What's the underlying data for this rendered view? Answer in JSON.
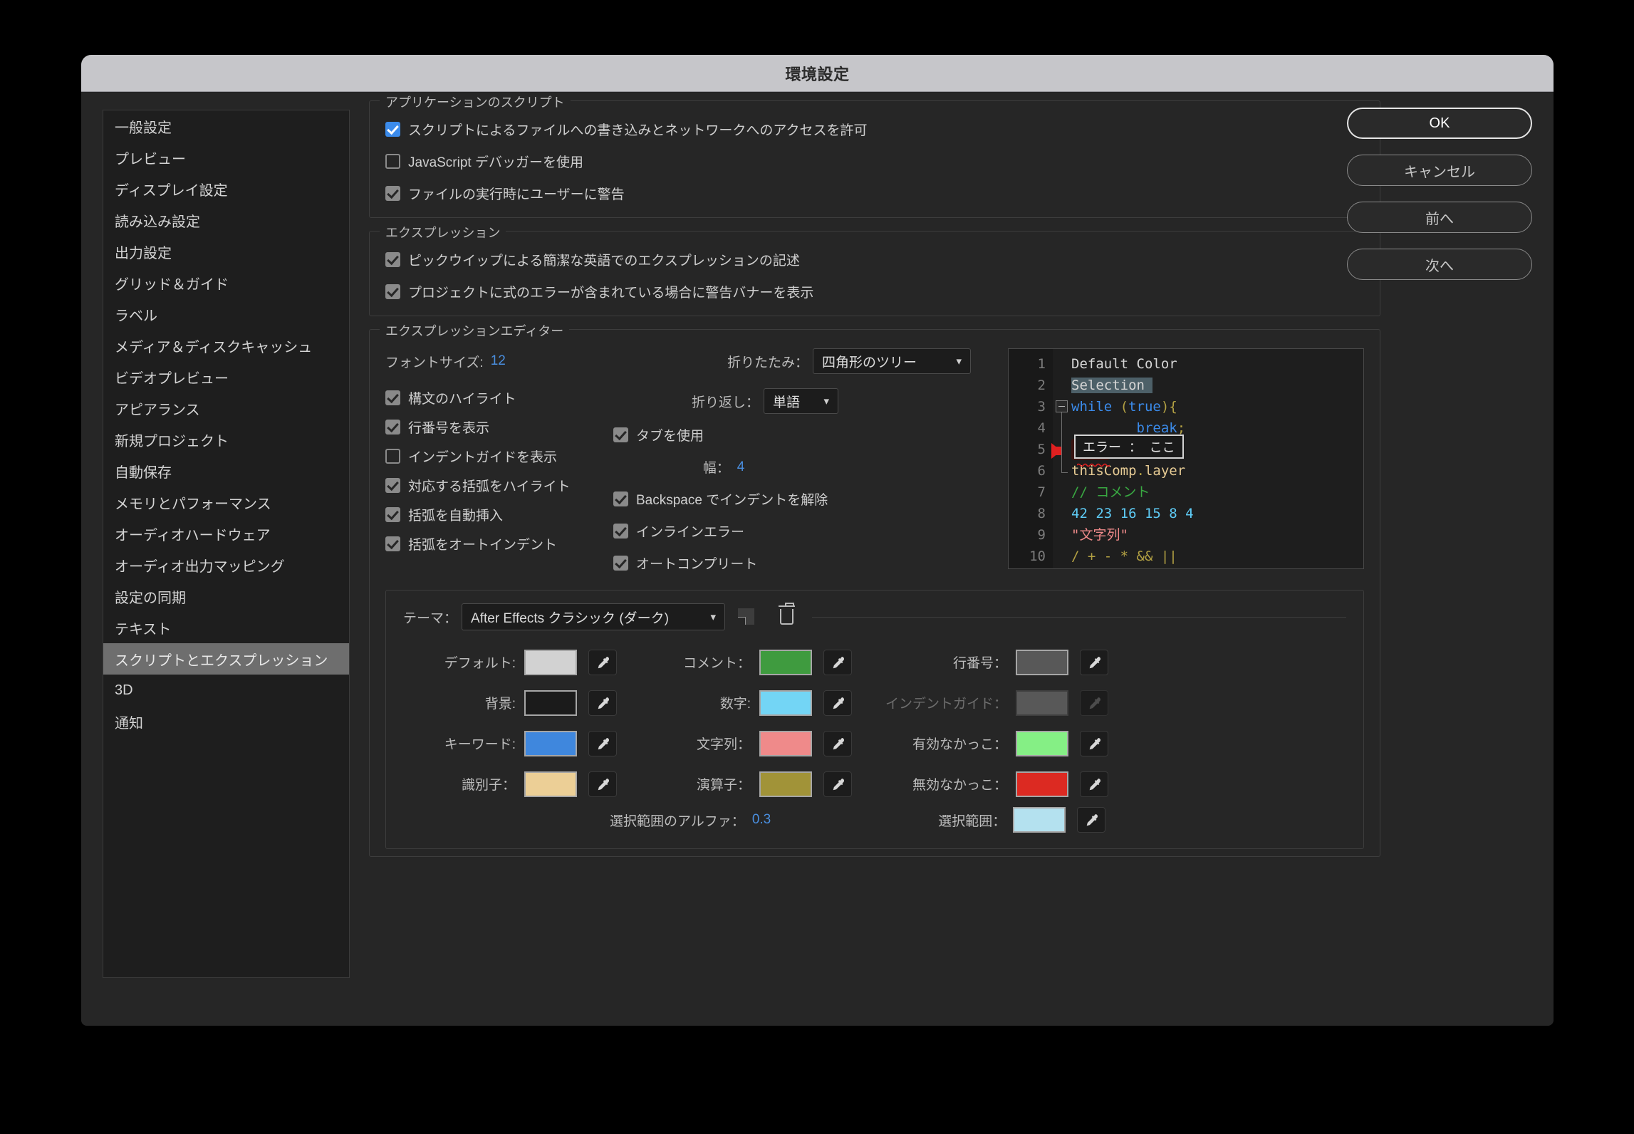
{
  "dialog": {
    "title": "環境設定"
  },
  "sidebar": {
    "items": [
      {
        "label": "一般設定",
        "selected": false
      },
      {
        "label": "プレビュー",
        "selected": false
      },
      {
        "label": "ディスプレイ設定",
        "selected": false
      },
      {
        "label": "読み込み設定",
        "selected": false
      },
      {
        "label": "出力設定",
        "selected": false
      },
      {
        "label": "グリッド＆ガイド",
        "selected": false
      },
      {
        "label": "ラベル",
        "selected": false
      },
      {
        "label": "メディア＆ディスクキャッシュ",
        "selected": false
      },
      {
        "label": "ビデオプレビュー",
        "selected": false
      },
      {
        "label": "アピアランス",
        "selected": false
      },
      {
        "label": "新規プロジェクト",
        "selected": false
      },
      {
        "label": "自動保存",
        "selected": false
      },
      {
        "label": "メモリとパフォーマンス",
        "selected": false
      },
      {
        "label": "オーディオハードウェア",
        "selected": false
      },
      {
        "label": "オーディオ出力マッピング",
        "selected": false
      },
      {
        "label": "設定の同期",
        "selected": false
      },
      {
        "label": "テキスト",
        "selected": false
      },
      {
        "label": "スクリプトとエクスプレッション",
        "selected": true
      },
      {
        "label": "3D",
        "selected": false
      },
      {
        "label": "通知",
        "selected": false
      }
    ]
  },
  "buttons": {
    "ok": "OK",
    "cancel": "キャンセル",
    "prev": "前へ",
    "next": "次へ"
  },
  "app_scripts": {
    "legend": "アプリケーションのスクリプト",
    "items": [
      {
        "label": "スクリプトによるファイルへの書き込みとネットワークへのアクセスを許可",
        "checked": true,
        "accent": true
      },
      {
        "label": "JavaScript デバッガーを使用",
        "checked": false,
        "accent": false
      },
      {
        "label": "ファイルの実行時にユーザーに警告",
        "checked": true,
        "accent": false
      }
    ]
  },
  "expressions": {
    "legend": "エクスプレッション",
    "items": [
      {
        "label": "ピックウイップによる簡潔な英語でのエクスプレッションの記述",
        "checked": true
      },
      {
        "label": "プロジェクトに式のエラーが含まれている場合に警告バナーを表示",
        "checked": true
      }
    ]
  },
  "editor": {
    "legend": "エクスプレッションエディター",
    "font_size_label": "フォントサイズ:",
    "font_size_value": "12",
    "fold_label": "折りたたみ：",
    "fold_value": "四角形のツリー",
    "wrap_label": "折り返し：",
    "wrap_value": "単語",
    "width_label": "幅：",
    "width_value": "4",
    "left_checks": [
      {
        "label": "構文のハイライト",
        "checked": true
      },
      {
        "label": "行番号を表示",
        "checked": true
      },
      {
        "label": "インデントガイドを表示",
        "checked": false
      },
      {
        "label": "対応する括弧をハイライト",
        "checked": true
      },
      {
        "label": "括弧を自動挿入",
        "checked": true
      },
      {
        "label": "括弧をオートインデント",
        "checked": true
      }
    ],
    "right_checks": [
      {
        "label": "タブを使用",
        "checked": true
      },
      {
        "label": "Backspace でインデントを解除",
        "checked": true
      },
      {
        "label": "インラインエラー",
        "checked": true
      },
      {
        "label": "オートコンプリート",
        "checked": true
      }
    ]
  },
  "code_preview": {
    "line_numbers": [
      "1",
      "2",
      "3",
      "4",
      "5",
      "6",
      "7",
      "8",
      "9",
      "10"
    ],
    "lines": [
      "Default Color",
      "Selection",
      "while (true){",
      "        break;",
      "}  }",
      "thisComp.layer",
      "// コメント",
      "42 23 16 15 8 4",
      "\"文字列\"",
      "/ + - * && ||"
    ],
    "error_tooltip": "エラー ： ここ"
  },
  "theme": {
    "label": "テーマ：",
    "value": "After Effects クラシック (ダーク)",
    "swatches_left": [
      {
        "label": "デフォルト:",
        "color": "#d2d2d2",
        "dim": false
      },
      {
        "label": "背景:",
        "color": "#1b1b1b",
        "dim": false
      },
      {
        "label": "キーワード:",
        "color": "#3f87dd",
        "dim": false
      },
      {
        "label": "識別子：",
        "color": "#eccf96",
        "dim": false
      }
    ],
    "swatches_mid": [
      {
        "label": "コメント：",
        "color": "#3f9b3f",
        "dim": false
      },
      {
        "label": "数字:",
        "color": "#73d5f5",
        "dim": false
      },
      {
        "label": "文字列：",
        "color": "#ef8a8a",
        "dim": false
      },
      {
        "label": "演算子：",
        "color": "#a19338",
        "dim": false
      }
    ],
    "swatches_right": [
      {
        "label": "行番号：",
        "color": "#585858",
        "dim": false
      },
      {
        "label": "インデントガイド：",
        "color": "#585858",
        "dim": true
      },
      {
        "label": "有効なかっこ：",
        "color": "#85ef85",
        "dim": false
      },
      {
        "label": "無効なかっこ：",
        "color": "#dc2a22",
        "dim": false
      }
    ],
    "alpha_label": "選択範囲のアルファ：",
    "alpha_value": "0.3",
    "selection_label": "選択範囲：",
    "selection_color": "#b4e1ef"
  }
}
